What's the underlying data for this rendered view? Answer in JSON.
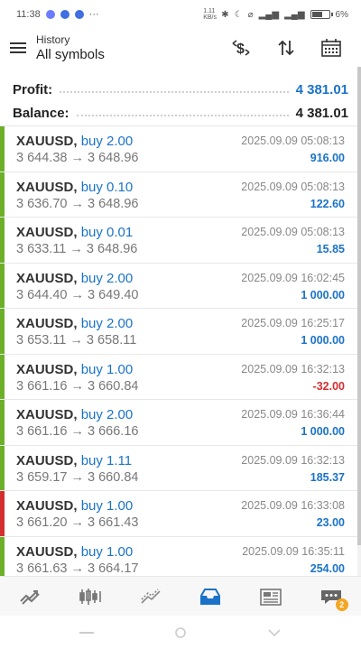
{
  "status_bar": {
    "time": "11:38",
    "indicators": "1.11 KB/s",
    "battery": "6%"
  },
  "header": {
    "subtitle": "History",
    "title": "All symbols"
  },
  "summary": {
    "profit_label": "Profit:",
    "profit_value": "4 381.01",
    "balance_label": "Balance:",
    "balance_value": "4 381.01"
  },
  "trades": [
    {
      "symbol": "XAUUSD,",
      "action": "buy 2.00",
      "prices": "3 644.38 → 3 648.96",
      "time": "2025.09.09 05:08:13",
      "profit": "916.00",
      "sign": "pos"
    },
    {
      "symbol": "XAUUSD,",
      "action": "buy 0.10",
      "prices": "3 636.70 → 3 648.96",
      "time": "2025.09.09 05:08:13",
      "profit": "122.60",
      "sign": "pos"
    },
    {
      "symbol": "XAUUSD,",
      "action": "buy 0.01",
      "prices": "3 633.11 → 3 648.96",
      "time": "2025.09.09 05:08:13",
      "profit": "15.85",
      "sign": "pos"
    },
    {
      "symbol": "XAUUSD,",
      "action": "buy 2.00",
      "prices": "3 644.40 → 3 649.40",
      "time": "2025.09.09 16:02:45",
      "profit": "1 000.00",
      "sign": "pos"
    },
    {
      "symbol": "XAUUSD,",
      "action": "buy 2.00",
      "prices": "3 653.11 → 3 658.11",
      "time": "2025.09.09 16:25:17",
      "profit": "1 000.00",
      "sign": "pos"
    },
    {
      "symbol": "XAUUSD,",
      "action": "buy 1.00",
      "prices": "3 661.16 → 3 660.84",
      "time": "2025.09.09 16:32:13",
      "profit": "-32.00",
      "sign": "neg"
    },
    {
      "symbol": "XAUUSD,",
      "action": "buy 2.00",
      "prices": "3 661.16 → 3 666.16",
      "time": "2025.09.09 16:36:44",
      "profit": "1 000.00",
      "sign": "pos"
    },
    {
      "symbol": "XAUUSD,",
      "action": "buy 1.11",
      "prices": "3 659.17 → 3 660.84",
      "time": "2025.09.09 16:32:13",
      "profit": "185.37",
      "sign": "pos"
    },
    {
      "symbol": "XAUUSD,",
      "action": "buy 1.00",
      "prices": "3 661.20 → 3 661.43",
      "time": "2025.09.09 16:33:08",
      "profit": "23.00",
      "sign": "pos",
      "bar": "red"
    },
    {
      "symbol": "XAUUSD,",
      "action": "buy 1.00",
      "prices": "3 661.63 → 3 664.17",
      "time": "2025.09.09 16:35:11",
      "profit": "254.00",
      "sign": "pos"
    }
  ],
  "colors": {
    "bar_green": "#6cb02a",
    "bar_red": "#d32f2f",
    "accent_blue": "#1a73c8",
    "loss_red": "#d32f2f"
  },
  "bottom_nav": {
    "items": [
      "quotes-icon",
      "chart-icon",
      "trade-icon",
      "history-icon",
      "news-icon",
      "chat-icon"
    ],
    "active": "history-icon",
    "chat_badge": "2"
  }
}
